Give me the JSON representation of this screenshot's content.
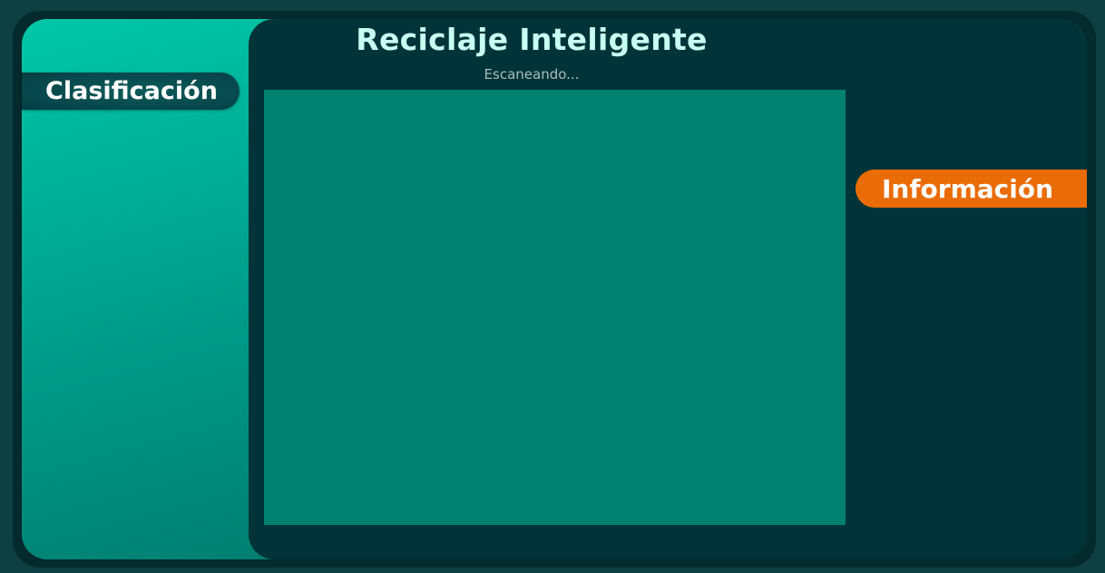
{
  "app": {
    "title": "Reciclaje Inteligente",
    "status": "Escaneando..."
  },
  "tabs": {
    "left_label": "Clasificación",
    "right_label": "Información"
  },
  "colors": {
    "background": "#0d3f43",
    "main_panel": "#003439",
    "left_panel_accent": "#00c7a8",
    "camera_view": "#008170",
    "info_tab": "#ea6c06",
    "title_text": "#c7fff2"
  }
}
